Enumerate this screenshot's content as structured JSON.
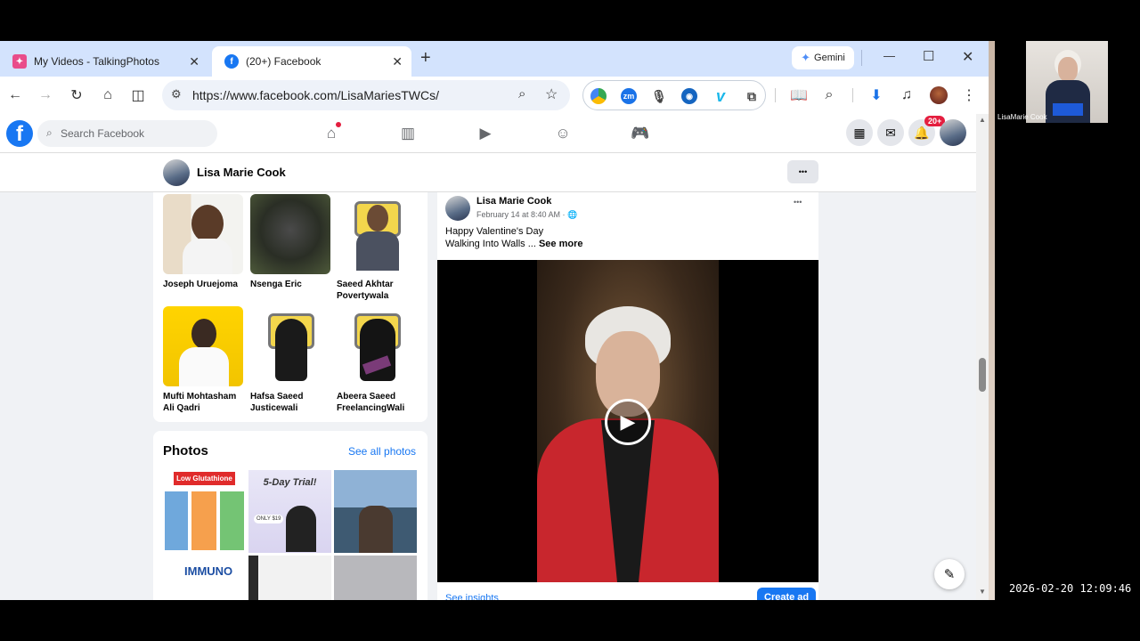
{
  "tabs": [
    {
      "title": "My Videos - TalkingPhotos",
      "close": "✕"
    },
    {
      "title": "(20+) Facebook",
      "close": "✕"
    }
  ],
  "new_tab": "+",
  "gemini": {
    "label": "Gemini"
  },
  "window_controls": {
    "minimize": "—",
    "maximize": "☐",
    "close": "✕"
  },
  "address": {
    "url": "https://www.facebook.com/LisaMariesTWCs/"
  },
  "extensions": {
    "zoom_label": "zm",
    "vimeo_label": "v"
  },
  "facebook": {
    "search_placeholder": "Search Facebook",
    "notifications_badge": "20+",
    "profile_name": "Lisa Marie Cook",
    "more": "•••",
    "friends": [
      {
        "name": "Joseph Uruejoma"
      },
      {
        "name": "Nsenga Eric"
      },
      {
        "name": "Saeed Akhtar Povertywala"
      },
      {
        "name": "Mufti Mohtasham Ali Qadri"
      },
      {
        "name": "Hafsa Saeed Justicewali"
      },
      {
        "name": "Abeera Saeed FreelancingWali"
      }
    ],
    "photos": {
      "title": "Photos",
      "see_all": "See all photos",
      "thumb1_label": "Low Glutathione",
      "thumb2_label": "5-Day Trial!",
      "thumb2_price": "ONLY $19",
      "thumb4_label": "IMMUNO"
    },
    "post": {
      "author": "Lisa Marie Cook",
      "meta": "February 14 at 8:40 AM · ",
      "line1": "Happy Valentine's Day",
      "line2": "Walking Into Walls ... ",
      "see_more": "See more",
      "see_insights": "See insights",
      "create_ad": "Create ad",
      "options": "•••"
    }
  },
  "overlay": {
    "webcam_name": "LisaMarie Cook",
    "timestamp": "2026-02-20 12:09:46"
  },
  "colors": {
    "facebook_blue": "#1877f2",
    "tabstrip": "#d3e3fd",
    "badge_red": "#e41e3f"
  }
}
